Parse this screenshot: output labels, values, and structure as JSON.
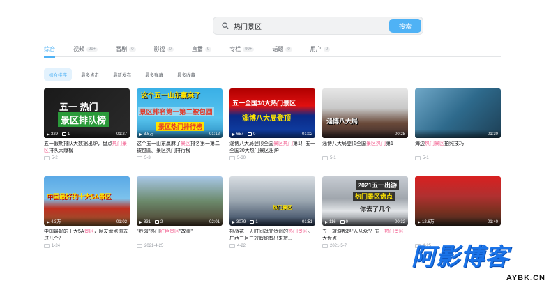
{
  "search": {
    "query": "热门景区",
    "button_label": "搜索"
  },
  "tabs": [
    {
      "label": "综合",
      "count": ""
    },
    {
      "label": "视频",
      "count": "99+"
    },
    {
      "label": "番剧",
      "count": "0"
    },
    {
      "label": "影视",
      "count": "0"
    },
    {
      "label": "直播",
      "count": "0"
    },
    {
      "label": "专栏",
      "count": "99+"
    },
    {
      "label": "话题",
      "count": "0"
    },
    {
      "label": "用户",
      "count": "0"
    }
  ],
  "sorts": [
    "综合排序",
    "最多点击",
    "最新发布",
    "最多弹幕",
    "最多收藏"
  ],
  "videos": [
    {
      "overlay_1": "五一 热门",
      "overlay_2": "景区排队榜",
      "plays": "329",
      "danmaku": "1",
      "duration": "01:27",
      "title_pre": "五一假期排队大数据出炉，盘点",
      "title_hl": "热门景区",
      "title_post": "排队大爆榜",
      "author": "5-2"
    },
    {
      "overlay_1": "这个五一山东赢麻了",
      "overlay_2": "景区排名第一第二被包圆",
      "overlay_3": "景区热门排行榜",
      "plays": "3.5万",
      "danmaku": "",
      "duration": "01:12",
      "title_pre": "这个五一山东赢麻了",
      "title_hl": "景区",
      "title_post": "排名第一第二被包圆。景区热门排行榜",
      "author": "5-3"
    },
    {
      "overlay_1": "五一全国30大热门景区",
      "overlay_2": "淄博八大局登顶",
      "plays": "657",
      "danmaku": "0",
      "duration": "01:02",
      "title_pre": "淄博八大局登顶全国",
      "title_hl": "景区热门",
      "title_post": "第1！五一全国30大热门景区出炉",
      "author": "5-30"
    },
    {
      "overlay_1": "淄博八大局",
      "overlay_2": "",
      "plays": "",
      "danmaku": "",
      "duration": "00:28",
      "title_pre": "淄博八大局登顶全国",
      "title_hl": "景区热门",
      "title_post": "第1",
      "author": "5-1"
    },
    {
      "overlay_1": "",
      "overlay_2": "",
      "plays": "",
      "danmaku": "",
      "duration": "01:30",
      "title_pre": "海边",
      "title_hl": "热门景区",
      "title_post": "拍照技巧",
      "author": "5-1"
    },
    {
      "overlay_1": "中国最好的十大5A景区",
      "overlay_2": "",
      "plays": "4.3万",
      "danmaku": "",
      "duration": "01:02",
      "title_pre": "中国最好的十大5A",
      "title_hl": "景区",
      "title_post": "，网友盘点你去过几个？",
      "author": "1-24"
    },
    {
      "overlay_1": "",
      "overlay_2": "",
      "plays": "831",
      "danmaku": "2",
      "duration": "02:01",
      "title_pre": "\"黔邻\"热门",
      "title_hl": "红色景区",
      "title_post": "\"故事\"",
      "author": "2021-4-25"
    },
    {
      "overlay_1": "热门景区",
      "overlay_2": "",
      "plays": "3079",
      "danmaku": "1",
      "duration": "01:51",
      "title_pre": "挑战花一天时间逛完贺州的",
      "title_hl": "热门景区",
      "title_post": "。广西三月三放假你有出来旅...",
      "author": "4-22"
    },
    {
      "overlay_1": "2021五一出游",
      "overlay_2": "热门景区盘点",
      "overlay_3": "你去了几个",
      "plays": "116",
      "danmaku": "0",
      "duration": "00:32",
      "title_pre": "五一旅游都是\"人从众\"？五一",
      "title_hl": "热门景区",
      "title_post": "大盘点",
      "author": "2021-5-7"
    },
    {
      "overlay_1": "",
      "overlay_2": "",
      "plays": "12.6万",
      "danmaku": "",
      "duration": "01:40",
      "title_pre": "",
      "title_hl": "",
      "title_post": "",
      "author": "4-25"
    }
  ],
  "watermark": {
    "main": "阿影博客",
    "sub": "AYBK.CN"
  }
}
